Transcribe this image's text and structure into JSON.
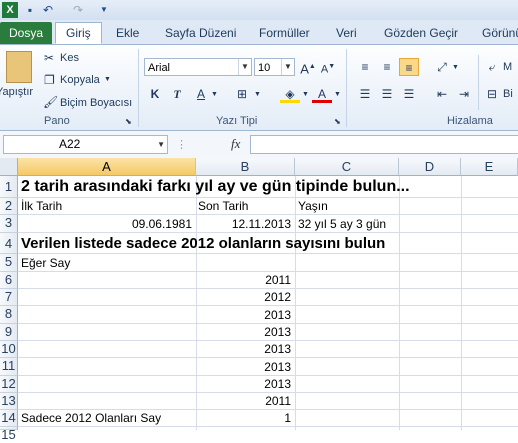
{
  "quick_access": {
    "undo": "↶",
    "redo": "↷"
  },
  "ribbon_tabs": [
    "Dosya",
    "Giriş",
    "Ekle",
    "Sayfa Düzeni",
    "Formüller",
    "Veri",
    "Gözden Geçir",
    "Görünüm"
  ],
  "clipboard": {
    "paste_label": "Yapıştır",
    "cut_label": "Kes",
    "copy_label": "Kopyala",
    "format_painter_label": "Biçim Boyacısı",
    "group_label": "Pano"
  },
  "font": {
    "family": "Arial",
    "size": "10",
    "group_label": "Yazı Tipi",
    "bold": "K",
    "italic": "T",
    "underline": "A"
  },
  "alignment": {
    "group_label": "Hizalama",
    "wrap_label": "M",
    "merge_label": "Bi"
  },
  "formula_bar": {
    "name_box": "A22",
    "fx": "fx",
    "formula": ""
  },
  "columns": [
    "A",
    "B",
    "C",
    "D",
    "E"
  ],
  "rows": [
    "1",
    "2",
    "3",
    "4",
    "5",
    "6",
    "7",
    "8",
    "9",
    "10",
    "11",
    "12",
    "13",
    "14",
    "15"
  ],
  "cells": {
    "r1_a": "2 tarih arasındaki farkı yıl ay ve gün tipinde bulun...",
    "r2_a": "İlk Tarih",
    "r2_b": "Son Tarih",
    "r2_c": "Yaşın",
    "r3_a": "09.06.1981",
    "r3_b": "12.11.2013",
    "r3_c": "32 yıl 5 ay 3 gün",
    "r4_a": "Verilen listede sadece 2012 olanların sayısını bulun",
    "r5_a": "Eğer Say",
    "r6_b": "2011",
    "r7_b": "2012",
    "r8_b": "2013",
    "r9_b": "2013",
    "r10_b": "2013",
    "r11_b": "2013",
    "r12_b": "2013",
    "r13_b": "2011",
    "r14_a": "Sadece 2012 Olanları Say",
    "r14_b": "1"
  },
  "colors": {
    "file_tab": "#2a7c3c",
    "active_header": "#f4c965"
  }
}
